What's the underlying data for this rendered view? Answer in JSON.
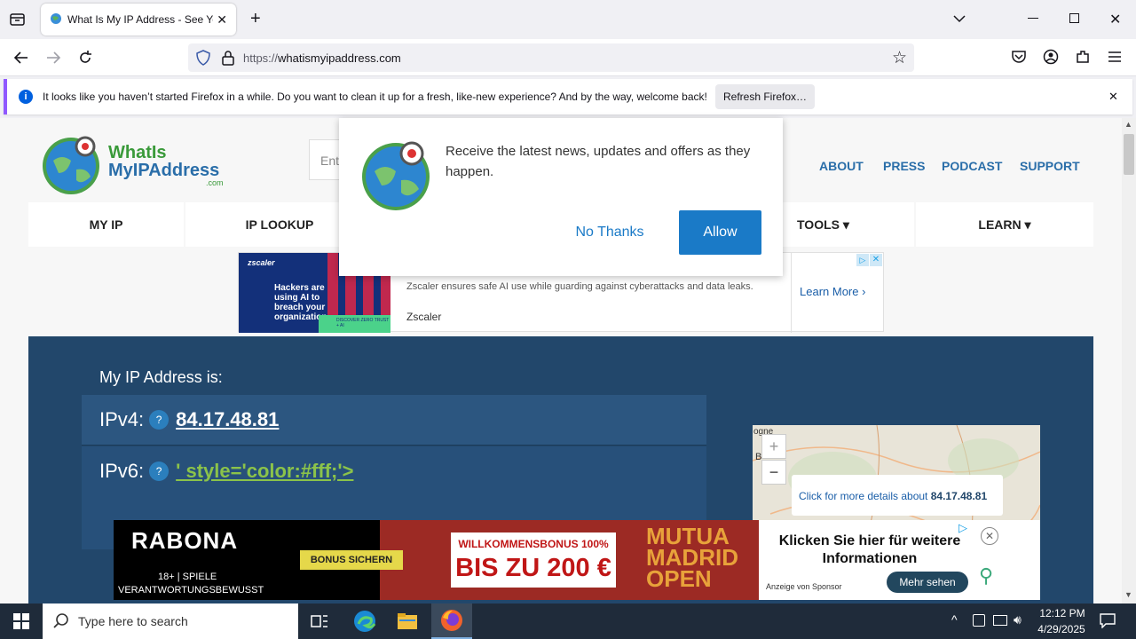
{
  "browser": {
    "tab_title": "What Is My IP Address - See Yo",
    "new_tab_symbol": "+",
    "url_scheme": "https://",
    "url_host": "whatismyipaddress.com"
  },
  "notice": {
    "message": "It looks like you haven’t started Firefox in a while. Do you want to clean it up for a fresh, like-new experience? And by the way, welcome back!",
    "button": "Refresh Firefox…"
  },
  "site": {
    "logo_line1": "WhatIs",
    "logo_line2": "MyIPAddress",
    "logo_line3": ".com",
    "search_placeholder": "Ent",
    "top_links": [
      "ABOUT",
      "PRESS",
      "PODCAST",
      "SUPPORT"
    ],
    "menu": [
      "MY IP",
      "IP LOOKUP",
      "TOOLS ▾",
      "LEARN ▾"
    ]
  },
  "popup": {
    "message": "Receive the latest news, updates and offers as they happen.",
    "no_thanks": "No Thanks",
    "allow": "Allow"
  },
  "ad_top": {
    "brand": "zscaler",
    "headline": "Hackers are using AI to breach your organization",
    "cta_small": "DISCOVER ZERO TRUST + AI",
    "body": "Zscaler ensures safe AI use while guarding against cyberattacks and data leaks.",
    "advertiser": "Zscaler",
    "learn_more": "Learn More"
  },
  "ip": {
    "heading": "My IP Address is:",
    "ipv4_label": "IPv4:",
    "ipv4_value": "84.17.48.81",
    "ipv6_label": "IPv6:",
    "ipv6_value": "' style='color:#fff;'>",
    "q": "?"
  },
  "map": {
    "zoom_in": "+",
    "zoom_out": "−",
    "details_prefix": "Click for more details about ",
    "details_ip": "84.17.48.81",
    "corner_text": "ogne",
    "corner_letter": "B"
  },
  "ad_bottom": {
    "brand": "RABONA",
    "bonus_btn": "BONUS SICHERN",
    "age": "18+ | SPIELE",
    "resp": "VERANTWORTUNGSBEWUSST",
    "welcome": "WILLKOMMENSBONUS 100%",
    "amount": "BIS ZU 200 €",
    "event1": "MUTUA",
    "event2": "MADRID",
    "event3": "OPEN",
    "click_text": "Klicken Sie hier für weitere Informationen",
    "sponsor": "Anzeige von Sponsor",
    "more": "Mehr sehen"
  },
  "taskbar": {
    "search_placeholder": "Type here to search",
    "time": "12:12 PM",
    "date": "4/29/2025"
  },
  "colors": {
    "site_blue": "#22476b",
    "allow_blue": "#1a7ac7",
    "green_link": "#8bc34a"
  }
}
